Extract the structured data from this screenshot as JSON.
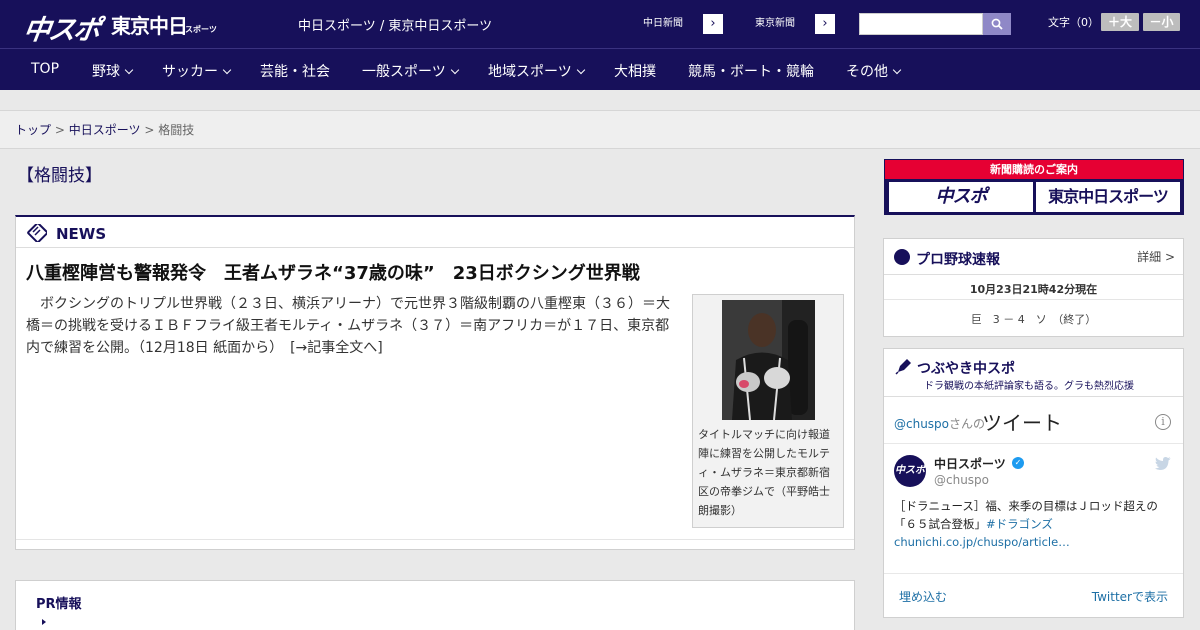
{
  "header": {
    "logo_chuspo": "中スポ",
    "logo_tokyo": "東京中日",
    "logo_tokyo_sub": "スポーツ",
    "site_names": "中日スポーツ / 東京中日スポーツ",
    "ext_links": [
      {
        "label": "中日新聞",
        "arrow": "›"
      },
      {
        "label": "東京新聞",
        "arrow": "›"
      }
    ],
    "search": {
      "placeholder": "",
      "value": ""
    },
    "font_size_label": "文字（0）",
    "font_larger": "＋大",
    "font_smaller": "－小"
  },
  "nav": {
    "items": [
      {
        "label": "TOP",
        "dropdown": false
      },
      {
        "label": "野球",
        "dropdown": true
      },
      {
        "label": "サッカー",
        "dropdown": true
      },
      {
        "label": "芸能・社会",
        "dropdown": false
      },
      {
        "label": "一般スポーツ",
        "dropdown": true
      },
      {
        "label": "地域スポーツ",
        "dropdown": true
      },
      {
        "label": "大相撲",
        "dropdown": false
      },
      {
        "label": "競馬・ボート・競輪",
        "dropdown": false
      },
      {
        "label": "その他",
        "dropdown": true
      }
    ]
  },
  "breadcrumb": {
    "items": [
      "トップ",
      "中日スポーツ",
      "格闘技"
    ],
    "separator": ">"
  },
  "page": {
    "title": "【格闘技】"
  },
  "news": {
    "section_label": "NEWS",
    "headline": "八重樫陣営も警報発令　王者ムザラネ“37歳の味”　23日ボクシング世界戦",
    "body": "ボクシングのトリプル世界戦（２３日、横浜アリーナ）で元世界３階級制覇の八重樫東（３６）＝大橋＝の挑戦を受けるＩＢＦフライ級王者モルティ・ムザラネ（３７）＝南アフリカ＝が１７日、東京都内で練習を公開。（12月18日 紙面から）",
    "more_link": "[→記事全文へ]",
    "photo_caption": "タイトルマッチに向け報道陣に練習を公開したモルティ・ムザラネ＝東京都新宿区の帝拳ジムで（平野皓士朗撮影）"
  },
  "pr": {
    "title": "PR情報"
  },
  "sidebar": {
    "subscribe": {
      "top": "新聞購読のご案内",
      "logo_a": "中スポ",
      "logo_b": "東京中日スポーツ"
    },
    "baseball": {
      "title": "プロ野球速報",
      "detail_link": "詳細 >",
      "updated": "10月23日21時42分現在",
      "result": "巨　3 － 4　ソ　（終了）"
    },
    "tweets": {
      "title": "つぶやき中スポ",
      "subtitle": "ドラ観戦の本紙評論家も語る。グラも熱烈応援",
      "handle": "@chuspo",
      "handle_suffix": "さんの",
      "big_label": "ツイート",
      "info": "i",
      "avatar_text": "中スポ",
      "name": "中日スポーツ",
      "user_id": "@chuspo",
      "tweet_text": "［ドラニュース］福、来季の目標はＪロッド超えの「６５試合登板」",
      "tweet_tag": "#ドラゴンズ",
      "tweet_link": "chunichi.co.jp/chuspo/article…",
      "embed_label": "埋め込む",
      "view_label": "Twitterで表示"
    }
  },
  "colors": {
    "brand_navy": "#17105a",
    "accent_red": "#e60033",
    "twitter_blue": "#1d9bf0"
  }
}
